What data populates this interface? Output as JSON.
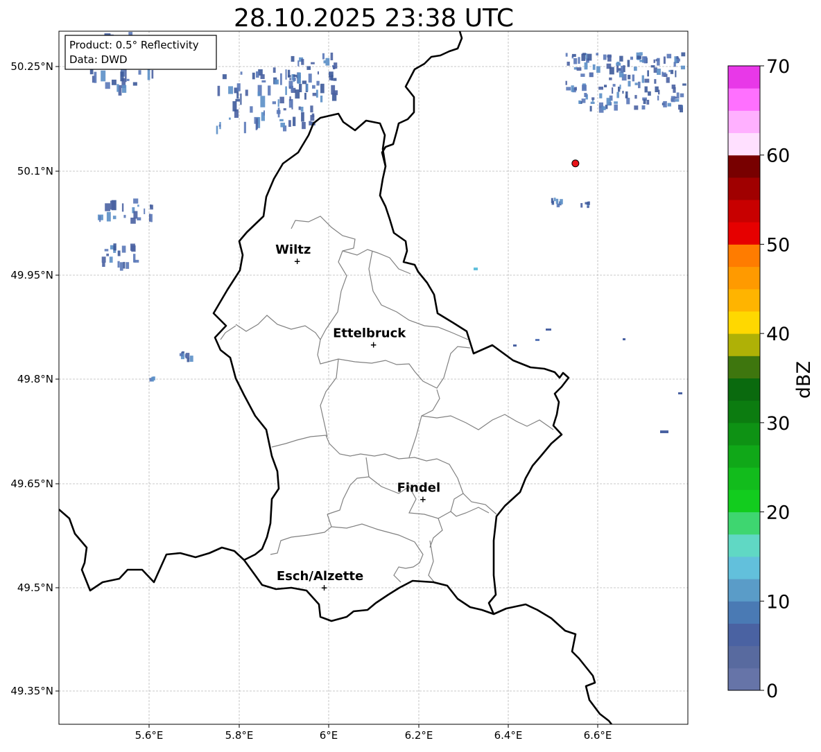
{
  "title": "28.10.2025 23:38 UTC",
  "info": {
    "product": "Product: 0.5° Reflectivity",
    "data": "Data: DWD"
  },
  "lon_ticks": [
    "5.6°E",
    "5.8°E",
    "6°E",
    "6.2°E",
    "6.4°E",
    "6.6°E"
  ],
  "lat_ticks": [
    "50.25°N",
    "50.1°N",
    "49.95°N",
    "49.8°N",
    "49.65°N",
    "49.5°N",
    "49.35°N"
  ],
  "places": [
    {
      "name": "Wiltz",
      "lon": 5.93,
      "lat": 49.97
    },
    {
      "name": "Ettelbruck",
      "lon": 6.1,
      "lat": 49.85
    },
    {
      "name": "Findel",
      "lon": 6.21,
      "lat": 49.627
    },
    {
      "name": "Esch/Alzette",
      "lon": 5.99,
      "lat": 49.5
    }
  ],
  "radar_site": {
    "lon": 6.55,
    "lat": 50.111,
    "color": "#e8141a"
  },
  "colorbar": {
    "label": "dBZ",
    "ticks": [
      "0",
      "10",
      "20",
      "30",
      "40",
      "50",
      "60",
      "70"
    ],
    "colors": [
      "#6674a8",
      "#586a9f",
      "#4a62a2",
      "#4a7ab4",
      "#5a9cc8",
      "#62c0dc",
      "#60d8c4",
      "#3ed670",
      "#12cc1e",
      "#12bc1c",
      "#10a818",
      "#0e9214",
      "#0c7c10",
      "#0a6a0e",
      "#3e760e",
      "#afb106",
      "#ffd800",
      "#ffb400",
      "#ff9a00",
      "#ff7c00",
      "#e60000",
      "#c80000",
      "#a00000",
      "#780000",
      "#ffe0ff",
      "#ffb0ff",
      "#ff70ff",
      "#e838e8"
    ]
  },
  "echo_colors": [
    "#4a62a2",
    "#5a78b8",
    "#3d5a9a",
    "#5b8fc6",
    "#62c0dc"
  ]
}
